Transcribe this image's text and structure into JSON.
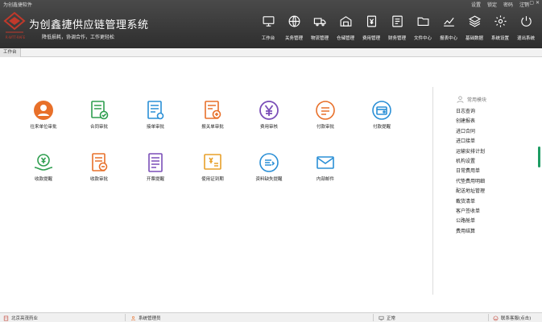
{
  "window": {
    "app_name": "为创鑫捷软件",
    "controls": "— ▢ ✕"
  },
  "top_menu": [
    "设置",
    "锁定",
    "密码",
    "注销"
  ],
  "brand": {
    "title": "为创鑫捷供应链管理系统",
    "slogan": "降低损耗，协调合作，工作更轻松",
    "logo_text": "R·WTT·RAFE"
  },
  "nav": [
    {
      "label": "工作台",
      "icon": "monitor-icon"
    },
    {
      "label": "关务管理",
      "icon": "globe-icon"
    },
    {
      "label": "物流管理",
      "icon": "truck-icon"
    },
    {
      "label": "仓储管理",
      "icon": "warehouse-icon"
    },
    {
      "label": "费用管理",
      "icon": "yen-doc-icon"
    },
    {
      "label": "财务管理",
      "icon": "finance-icon"
    },
    {
      "label": "文件中心",
      "icon": "folder-icon"
    },
    {
      "label": "报表中心",
      "icon": "chart-icon"
    },
    {
      "label": "基础数据",
      "icon": "layers-icon"
    },
    {
      "label": "系统设置",
      "icon": "gear-icon"
    },
    {
      "label": "退出系统",
      "icon": "power-icon"
    }
  ],
  "tab": "工作台",
  "modules": [
    {
      "label": "往来单位审批",
      "color": "#e8702a",
      "icon": "person-approve-icon"
    },
    {
      "label": "合同审批",
      "color": "#2e9e4f",
      "icon": "contract-icon"
    },
    {
      "label": "接单审批",
      "color": "#2a8fd6",
      "icon": "order-doc-icon"
    },
    {
      "label": "报关单审批",
      "color": "#e8702a",
      "icon": "customs-doc-icon"
    },
    {
      "label": "费用审核",
      "color": "#7b4fb8",
      "icon": "yen-icon"
    },
    {
      "label": "付款审批",
      "color": "#e8702a",
      "icon": "pay-list-icon"
    },
    {
      "label": "付款提醒",
      "color": "#2a8fd6",
      "icon": "wallet-icon"
    },
    {
      "label": "收款提醒",
      "color": "#2e9e4f",
      "icon": "receive-money-icon"
    },
    {
      "label": "收款审批",
      "color": "#e8702a",
      "icon": "receipt-icon"
    },
    {
      "label": "开票提醒",
      "color": "#7b4fb8",
      "icon": "invoice-icon"
    },
    {
      "label": "使用证到期",
      "color": "#e8a02a",
      "icon": "license-icon"
    },
    {
      "label": "资料缺失提醒",
      "color": "#2a8fd6",
      "icon": "missing-doc-icon"
    },
    {
      "label": "内部邮件",
      "color": "#2a8fd6",
      "icon": "mail-icon"
    }
  ],
  "side": {
    "heading": "常用模块",
    "items": [
      "日志查询",
      "创建报表",
      "进口合同",
      "进口接单",
      "运输安排计划",
      "机构设置",
      "日常费用单",
      "代垫费用明细",
      "配送地址管理",
      "載货清单",
      "客户签收单",
      "公路舱单",
      "费用结算"
    ]
  },
  "status": {
    "company": "北京亮茂药业",
    "user": "系统管理员",
    "state": "正常",
    "contact": "联系客服(点击)"
  },
  "colors": {
    "header": "#3a3a3a",
    "accent": "#1e9c63",
    "brand_red": "#c0392b"
  }
}
